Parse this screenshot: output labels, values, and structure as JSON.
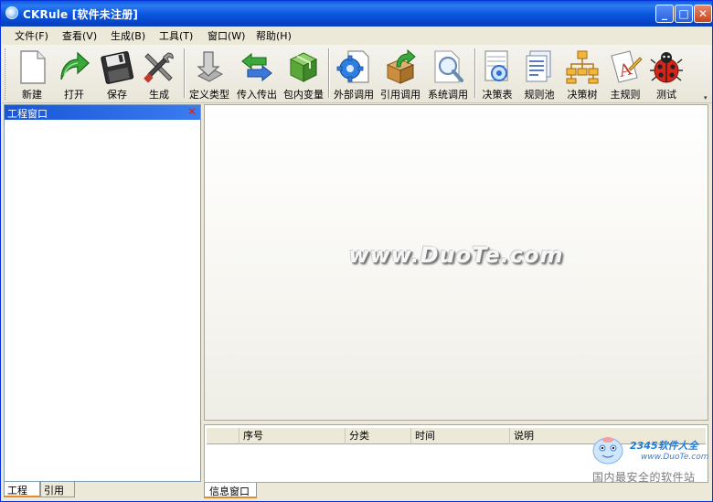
{
  "window": {
    "title": "CKRule [软件未注册]",
    "controls": {
      "minimize": "_",
      "maximize": "□",
      "close": "✕"
    }
  },
  "menu": [
    {
      "label": "文件(F)"
    },
    {
      "label": "查看(V)"
    },
    {
      "label": "生成(B)"
    },
    {
      "label": "工具(T)"
    },
    {
      "label": "窗口(W)"
    },
    {
      "label": "帮助(H)"
    }
  ],
  "toolbar": [
    {
      "label": "新建",
      "icon": "new-file-icon"
    },
    {
      "label": "打开",
      "icon": "open-arrow-icon"
    },
    {
      "label": "保存",
      "icon": "save-floppy-icon"
    },
    {
      "label": "生成",
      "icon": "build-tools-icon"
    },
    {
      "label": "定义类型",
      "icon": "define-type-icon"
    },
    {
      "label": "传入传出",
      "icon": "in-out-arrows-icon"
    },
    {
      "label": "包内变量",
      "icon": "package-variable-icon"
    },
    {
      "label": "外部调用",
      "icon": "external-call-gear-icon"
    },
    {
      "label": "引用调用",
      "icon": "reference-call-box-icon"
    },
    {
      "label": "系统调用",
      "icon": "system-call-magnifier-icon"
    },
    {
      "label": "决策表",
      "icon": "decision-table-icon"
    },
    {
      "label": "规则池",
      "icon": "rule-pool-icon"
    },
    {
      "label": "决策树",
      "icon": "decision-tree-icon"
    },
    {
      "label": "主规则",
      "icon": "main-rule-icon"
    },
    {
      "label": "测试",
      "icon": "test-ladybug-icon"
    }
  ],
  "project_panel": {
    "title": "工程窗口",
    "tabs": [
      "工程",
      "引用"
    ]
  },
  "main_area": {
    "watermark": "www.DuoTe.com"
  },
  "info_panel": {
    "columns": [
      "序号",
      "分类",
      "时间",
      "说明"
    ],
    "tab": "信息窗口"
  },
  "corner_logo": {
    "title": "2345软件大全",
    "url": "www.DuoTe.com",
    "slogan": "国内最安全的软件站"
  },
  "colors": {
    "title_bar": "#0b58df",
    "panel_head": "#1856d6",
    "active_tab_accent": "#e68b2c",
    "close_x": "#e02010"
  }
}
